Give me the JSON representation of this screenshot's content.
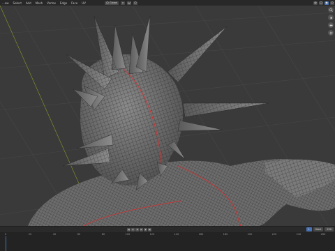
{
  "topbar": {
    "menu": [
      "...ew",
      "Select",
      "Add",
      "Mesh",
      "Vertex",
      "Edge",
      "Face",
      "UV"
    ],
    "pivot_label": "Global"
  },
  "timeline": {
    "frame_labels": [
      "0",
      "20",
      "40",
      "60",
      "80",
      "100",
      "120",
      "140",
      "160",
      "180",
      "200",
      "220",
      "240",
      "260"
    ],
    "current_frame": "1",
    "start_label": "Start",
    "end_frame": "250"
  },
  "colors": {
    "accent": "#4772b3",
    "seam": "#d23232",
    "mesh": "#777777"
  }
}
